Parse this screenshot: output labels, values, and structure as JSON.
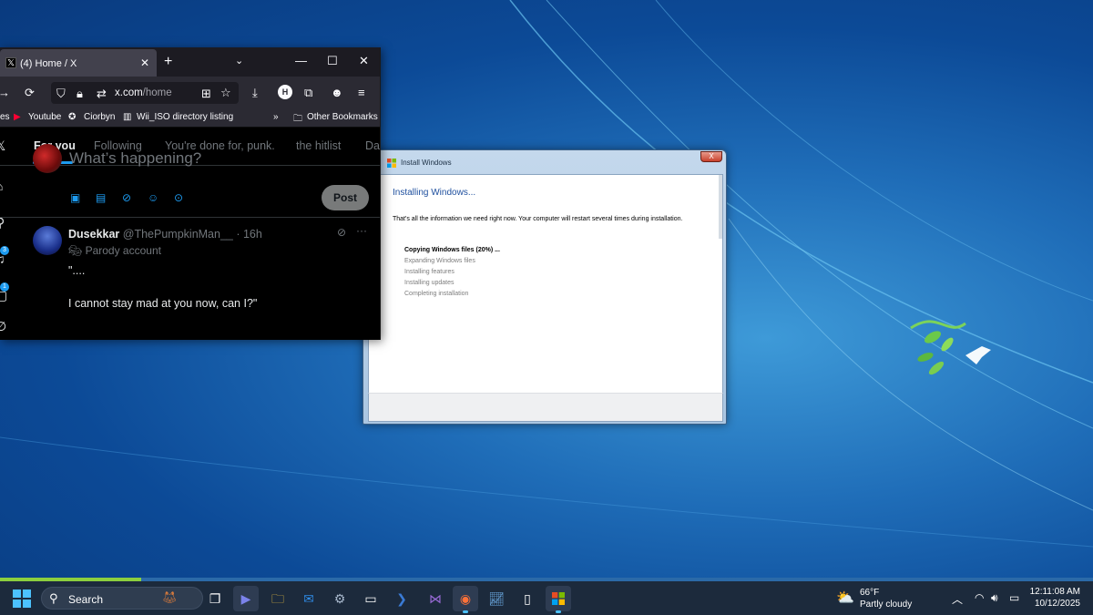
{
  "browser": {
    "tab_title": "(4) Home / X",
    "tab_close": "✕",
    "new_tab": "+",
    "tab_list": "⌄",
    "window_controls": {
      "minimize": "—",
      "maximize": "☐",
      "close": "✕"
    },
    "url_host": "x.com",
    "url_path": "/home",
    "bookmarks": [
      {
        "label": "es"
      },
      {
        "label": "Youtube"
      },
      {
        "label": "Ciorbyn"
      },
      {
        "label": "Wii_ISO directory listing"
      }
    ],
    "overflow": "»",
    "other_bookmarks": "Other Bookmarks"
  },
  "x_page": {
    "tabs": [
      "For you",
      "Following",
      "You're done for, punk.",
      "the hitlist",
      "Da"
    ],
    "compose_placeholder": "What’s happening?",
    "post_button": "Post",
    "badges": [
      "3",
      "1"
    ],
    "tweet": {
      "name": "Dusekkar",
      "handle": "@ThePumpkinMan__ · 16h",
      "parody": "Parody account",
      "body": "\"....\n\nI cannot stay mad at you now, can I?\""
    }
  },
  "install_dialog": {
    "title": "Install Windows",
    "close": "X",
    "heading": "Installing Windows...",
    "description": "That's all the information we need right now. Your computer will restart several times during installation.",
    "steps": [
      {
        "label": "Copying Windows files (20%) ...",
        "active": true
      },
      {
        "label": "Expanding Windows files",
        "active": false
      },
      {
        "label": "Installing features",
        "active": false
      },
      {
        "label": "Installing updates",
        "active": false
      },
      {
        "label": "Completing installation",
        "active": false
      }
    ]
  },
  "taskbar": {
    "search_label": "Search",
    "weather_temp": "66°F",
    "weather_condition": "Partly cloudy",
    "time": "12:11:08 AM",
    "date": "10/12/2025"
  },
  "colors": {
    "accent": "#1d9bf0",
    "install_heading": "#1e4f9e",
    "taskbar": "#1c2a3c"
  }
}
